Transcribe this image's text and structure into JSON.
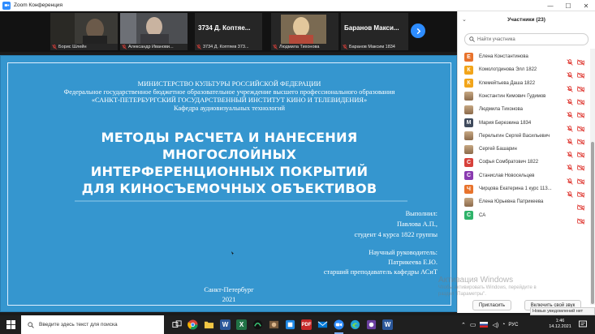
{
  "window": {
    "title": "Zoom Конференция"
  },
  "video_strip": {
    "tiles": [
      {
        "name": "Борис Шлейн",
        "muted": true,
        "video": "photo"
      },
      {
        "name": "Александр Иванови...",
        "muted": true,
        "video": "photo"
      },
      {
        "big_name": "3734 Д. Коптяе...",
        "name": "3734 Д. Коптяев 373...",
        "muted": true,
        "video": "none"
      },
      {
        "name": "Людмила Тихонова",
        "muted": true,
        "video": "photo"
      },
      {
        "big_name": "Баранов Макси...",
        "name": "Баранов Максим 1834",
        "muted": true,
        "video": "none"
      }
    ]
  },
  "slide": {
    "header_lines": [
      "МИНИСТЕРСТВО КУЛЬТУРЫ РОССИЙСКОЙ ФЕДЕРАЦИИ",
      "Федеральное государственное бюджетное образовательное учреждение высшего профессионального образования",
      "«САНКТ-ПЕТЕРБУРГСКИЙ ГОСУДАРСТВЕННЫЙ ИНСТИТУТ КИНО И ТЕЛЕВИДЕНИЯ»",
      "Кафедра аудиовизуальных технологий"
    ],
    "title_lines": [
      "МЕТОДЫ РАСЧЕТА И НАНЕСЕНИЯ",
      "МНОГОСЛОЙНЫХ",
      "ИНТЕРФЕРЕНЦИОННЫХ ПОКРЫТИЙ",
      "ДЛЯ КИНОСЪЕМОЧНЫХ ОБЪЕКТИВОВ"
    ],
    "author_lines": [
      "Выполнил:",
      "Павлова А.П.,",
      "студент 4 курса 1822 группы"
    ],
    "advisor_lines": [
      "Научный руководитель:",
      "Патрикеева Е.Ю.",
      "старший преподаватель кафедры АСиТ"
    ],
    "footer_lines": [
      "Санкт-Петербург",
      "2021"
    ]
  },
  "participants": {
    "title": "Участники (23)",
    "search_placeholder": "Найти участника",
    "items": [
      {
        "name": "Елена Константинова",
        "initial": "Е",
        "color": "#E8732C",
        "mic": "muted",
        "cam": "off"
      },
      {
        "name": "Комолотдинова Элл 1822",
        "initial": "К",
        "color": "#F2A51A",
        "mic": "muted",
        "cam": "off"
      },
      {
        "name": "Клемейтьева Даша 1822",
        "initial": "К",
        "color": "#F2A51A",
        "mic": "muted",
        "cam": "off"
      },
      {
        "name": "Константин Кимович Гудимов",
        "initial": "",
        "color": "photo",
        "mic": "muted",
        "cam": "off"
      },
      {
        "name": "Людмила Тихонова",
        "initial": "",
        "color": "photo",
        "mic": "muted",
        "cam": "off"
      },
      {
        "name": "Мария Березкина 1834",
        "initial": "М",
        "color": "#3F4A5C",
        "mic": "muted",
        "cam": "off"
      },
      {
        "name": "Перелыгин Сергей Васильевич",
        "initial": "",
        "color": "photo",
        "mic": "muted",
        "cam": "off"
      },
      {
        "name": "Сергей Башарин",
        "initial": "",
        "color": "photo",
        "mic": "muted",
        "cam": "off"
      },
      {
        "name": "Софья Сомбратович 1822",
        "initial": "С",
        "color": "#D7413B",
        "mic": "muted",
        "cam": "off"
      },
      {
        "name": "Станислав Новосельцев",
        "initial": "С",
        "color": "#8A3BB0",
        "mic": "muted",
        "cam": "off"
      },
      {
        "name": "Чирцова Екатерина 1 курс 113...",
        "initial": "Ч",
        "color": "#E8732C",
        "mic": "muted",
        "cam": "off"
      },
      {
        "name": "Елена Юрьевна Патрикеева",
        "initial": "",
        "color": "photo",
        "mic": "none",
        "cam": "off"
      },
      {
        "name": "СА",
        "initial": "С",
        "color": "#2FB36A",
        "mic": "none",
        "cam": "off"
      }
    ],
    "invite_label": "Пригласить",
    "unmute_label": "Включить свой звук"
  },
  "watermark": {
    "title": "Активация Windows",
    "line1": "Чтобы активировать Windows, перейдите в",
    "line2": "раздел \"Параметры\"."
  },
  "toast": "Новых уведомлений нет",
  "taskbar": {
    "search_placeholder": "Введите здесь текст для поиска",
    "lang": "РУС",
    "time": "1:46",
    "date": "14.12.2021"
  },
  "colors": {
    "zoom_blue": "#2D8CFF",
    "slide_bg": "#3596cf",
    "muted_red": "#E0403A"
  }
}
